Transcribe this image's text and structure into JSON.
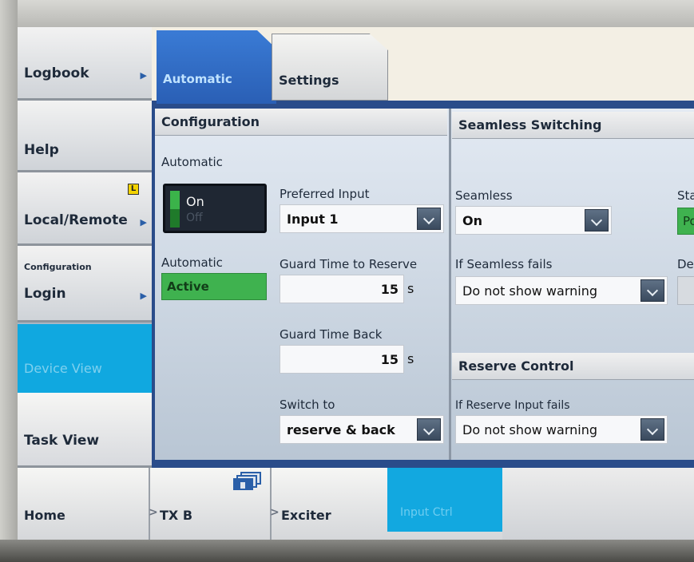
{
  "sidebar": {
    "items": [
      {
        "label": "Logbook",
        "arrow": "▶"
      },
      {
        "label": "Help"
      },
      {
        "label": "Local/Remote",
        "arrow": "▶",
        "badge": "L"
      },
      {
        "small_label": "Configuration",
        "label": "Login",
        "arrow": "▶"
      },
      {
        "label": "Device View",
        "active": true
      },
      {
        "label": "Task View"
      }
    ]
  },
  "tabs": [
    {
      "label": "Automatic",
      "active": true
    },
    {
      "label": "Settings",
      "active": false
    }
  ],
  "configuration": {
    "title": "Configuration",
    "automatic_label": "Automatic",
    "toggle": {
      "on": "On",
      "off": "Off",
      "state": "On"
    },
    "automatic_status_label": "Automatic",
    "automatic_status": "Active",
    "preferred_input_label": "Preferred Input",
    "preferred_input_value": "Input 1",
    "guard_reserve_label": "Guard Time to Reserve",
    "guard_reserve_value": "15",
    "guard_reserve_unit": "s",
    "guard_back_label": "Guard Time Back",
    "guard_back_value": "15",
    "guard_back_unit": "s",
    "switch_to_label": "Switch to",
    "switch_to_value": "reserve & back"
  },
  "seamless": {
    "title": "Seamless Switching",
    "seamless_label": "Seamless",
    "seamless_value": "On",
    "fails_label": "If Seamless fails",
    "fails_value": "Do not show warning",
    "status_label_partial": "Sta",
    "status_value_partial": "Po",
    "de_label_partial": "De"
  },
  "reserve": {
    "title": "Reserve Control",
    "fails_label": "If Reserve Input fails",
    "fails_value": "Do not show warning"
  },
  "bottom_nav": {
    "home": "Home",
    "crumbs": [
      "TX B",
      "Exciter",
      "Input Ctrl"
    ]
  },
  "colors": {
    "accent_blue": "#12a8e0",
    "tab_blue": "#3a7bd5",
    "status_green": "#3fb24f"
  }
}
